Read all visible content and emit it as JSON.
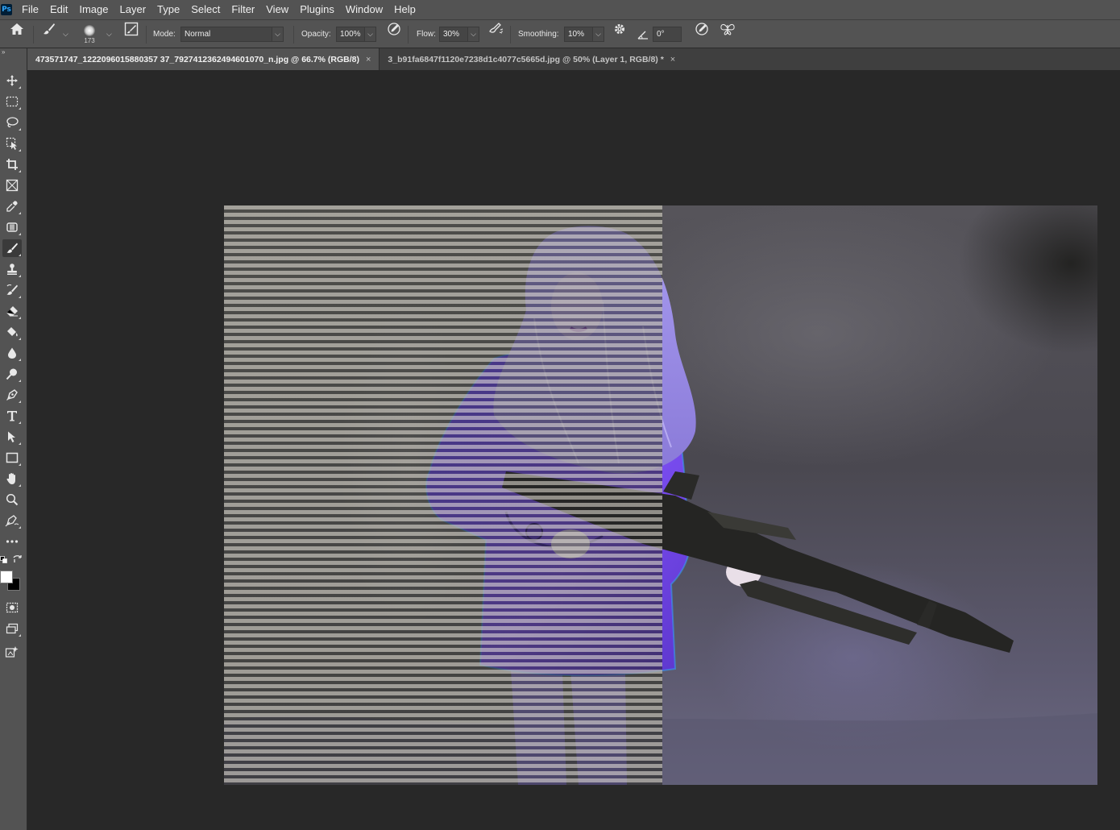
{
  "app": {
    "logo": "Ps"
  },
  "menu": [
    "File",
    "Edit",
    "Image",
    "Layer",
    "Type",
    "Select",
    "Filter",
    "View",
    "Plugins",
    "Window",
    "Help"
  ],
  "options": {
    "brush_size": "173",
    "mode_label": "Mode:",
    "mode_value": "Normal",
    "opacity_label": "Opacity:",
    "opacity_value": "100%",
    "flow_label": "Flow:",
    "flow_value": "30%",
    "smoothing_label": "Smoothing:",
    "smoothing_value": "10%",
    "angle_value": "0°"
  },
  "tabs": [
    {
      "label": "473571747_1222096015880357 37_7927412362494601070_n.jpg @ 66.7% (RGB/8)",
      "close": "×"
    },
    {
      "label": "3_b91fa6847f1120e7238d1c4077c5665d.jpg @ 50% (Layer 1, RGB/8) *",
      "close": "×"
    }
  ],
  "colors": {
    "foreground": "#ffffff",
    "background": "#000000",
    "accent": "#7a5cff"
  }
}
